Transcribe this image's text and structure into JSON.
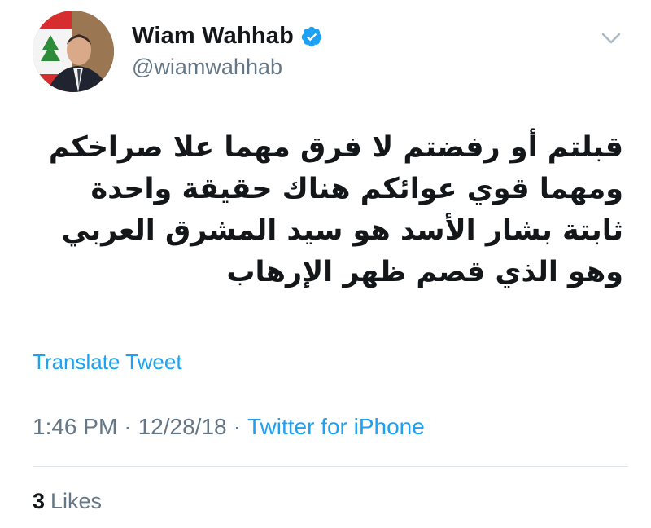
{
  "tweet": {
    "author": {
      "display_name": "Wiam Wahhab",
      "handle": "@wiamwahhab",
      "verified": true
    },
    "text": "قبلتم أو رفضتم لا فرق مهما علا صراخكم ومهما قوي عوائكم هناك حقيقة واحدة ثابتة بشار الأسد هو سيد المشرق العربي وهو الذي قصم ظهر الإرهاب",
    "translate_label": "Translate Tweet",
    "time": "1:46 PM",
    "separator": "·",
    "date": "12/28/18",
    "source": "Twitter for iPhone",
    "likes_count": "3",
    "likes_label": "Likes"
  },
  "colors": {
    "link": "#1da1f2",
    "secondary_text": "#657786",
    "verified_badge": "#1da1f2"
  },
  "icons": {
    "verified": "verified-badge-icon",
    "menu": "chevron-down-icon"
  }
}
